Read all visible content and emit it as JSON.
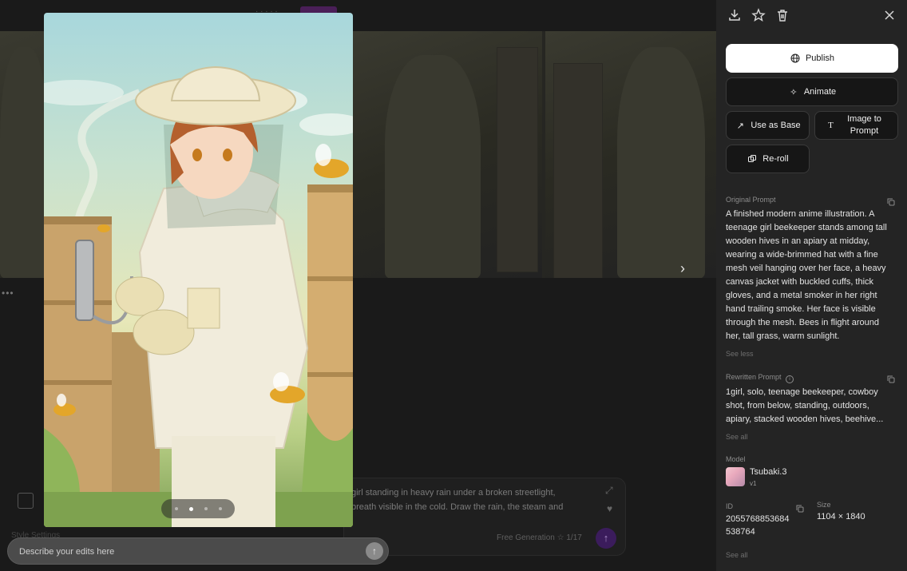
{
  "background": {
    "prompt_text": "girl standing in heavy rain under a broken streetlight, breath visible in the cold. Draw the rain, the steam and",
    "free_generation": "Free Generation",
    "free_generation_count": "1/17",
    "bottom_row_text": "Style  Settings"
  },
  "preview": {
    "carousel": {
      "count": 4,
      "active_index": 1
    }
  },
  "edit": {
    "placeholder": "Describe your edits here"
  },
  "panel": {
    "toolbar": [
      "download-icon",
      "star-icon",
      "trash-icon",
      "close-icon"
    ],
    "publish_label": "Publish",
    "animate_label": "Animate",
    "use_as_base_label": "Use as Base",
    "image_to_prompt_label": "Image to Prompt",
    "reroll_label": "Re-roll",
    "original_prompt_label": "Original Prompt",
    "original_prompt": "A finished modern anime illustration. A teenage girl beekeeper stands among tall wooden hives in an apiary at midday, wearing a wide-brimmed hat with a fine mesh veil hanging over her face, a heavy canvas jacket with buckled cuffs, thick gloves, and a metal smoker in her right hand trailing smoke. Her face is visible through the mesh. Bees in flight around her, tall grass, warm sunlight.",
    "see_less": "See less",
    "rewritten_prompt_label": "Rewritten Prompt",
    "rewritten_prompt": "1girl, solo, teenage beekeeper, cowboy shot, from below, standing, outdoors, apiary, stacked wooden hives, beehive...",
    "see_all": "See all",
    "model_label": "Model",
    "model_name": "Tsubaki.3",
    "model_version": "v1",
    "id_label": "ID",
    "id_value": "2055768853684538764",
    "size_label": "Size",
    "size_value": "1104 × 1840",
    "see_all_bottom": "See all"
  },
  "colors": {
    "panel_bg": "#242424",
    "primary_button": "#ffffff",
    "accent_purple": "#3b1c5c"
  }
}
